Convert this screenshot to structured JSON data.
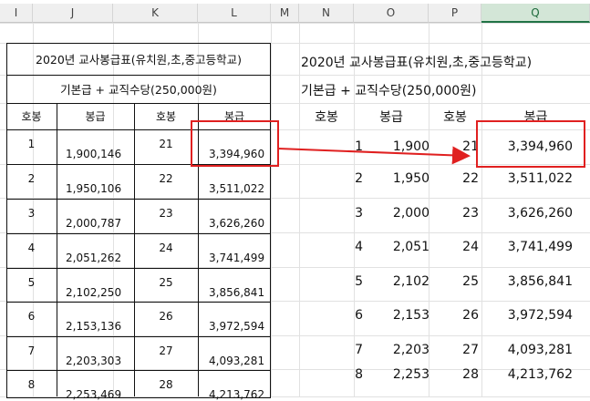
{
  "columns": [
    "I",
    "J",
    "K",
    "L",
    "M",
    "N",
    "O",
    "P",
    "Q"
  ],
  "left_table": {
    "title": "2020년 교사봉급표(유치원,초,중고등학교)",
    "subtitle": "기본급 + 교직수당(250,000원)",
    "headers": [
      "호봉",
      "봉급",
      "호봉",
      "봉급"
    ],
    "rows": [
      [
        "1",
        "1,900,146",
        "21",
        "3,394,960"
      ],
      [
        "2",
        "1,950,106",
        "22",
        "3,511,022"
      ],
      [
        "3",
        "2,000,787",
        "23",
        "3,626,260"
      ],
      [
        "4",
        "2,051,262",
        "24",
        "3,741,499"
      ],
      [
        "5",
        "2,102,250",
        "25",
        "3,856,841"
      ],
      [
        "6",
        "2,153,136",
        "26",
        "3,972,594"
      ],
      [
        "7",
        "2,203,303",
        "27",
        "4,093,281"
      ],
      [
        "8",
        "2,253,469",
        "28",
        "4,213,762"
      ]
    ]
  },
  "right_table": {
    "title": "2020년 교사봉급표(유치원,초,중고등학교)",
    "subtitle": "기본급 + 교직수당(250,000원)",
    "headers": [
      "호봉",
      "봉급",
      "호봉",
      "봉급"
    ],
    "rows": [
      [
        "1",
        "1,900",
        "21",
        "3,394,960"
      ],
      [
        "2",
        "1,950",
        "22",
        "3,511,022"
      ],
      [
        "3",
        "2,000",
        "23",
        "3,626,260"
      ],
      [
        "4",
        "2,051",
        "24",
        "3,741,499"
      ],
      [
        "5",
        "2,102",
        "25",
        "3,856,841"
      ],
      [
        "6",
        "2,153",
        "26",
        "3,972,594"
      ],
      [
        "7",
        "2,203",
        "27",
        "4,093,281"
      ],
      [
        "8",
        "2,253",
        "28",
        "4,213,762"
      ]
    ]
  },
  "colors": {
    "highlight": "#e02020",
    "selected_column": "#217346"
  }
}
